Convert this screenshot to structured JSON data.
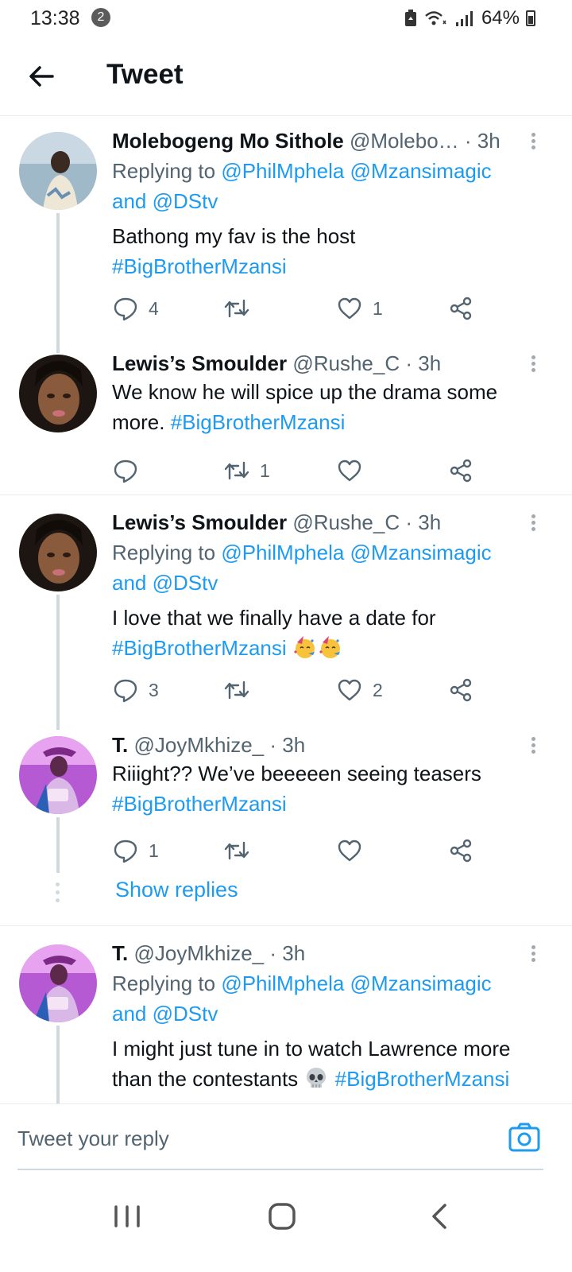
{
  "status_bar": {
    "time": "13:38",
    "notification_count": "2",
    "battery": "64%"
  },
  "header": {
    "title": "Tweet"
  },
  "tweets": [
    {
      "name": "Molebogeng Mo Sithole",
      "meta": "@Molebo… · 3h",
      "replying_prefix": "Replying to",
      "mentions": "@PhilMphela @Mzansimagic",
      "and_text": "and",
      "mention_last": "@DStv",
      "text_plain": "Bathong my fav is the host",
      "hashtag": "#BigBrotherMzansi",
      "reply_count": "4",
      "retweet_count": "",
      "like_count": "1"
    },
    {
      "name": "Lewis’s Smoulder",
      "meta": "@Rushe_C · 3h",
      "text_plain": "We know he will spice up the drama some more.",
      "hashtag": "#BigBrotherMzansi",
      "reply_count": "",
      "retweet_count": "1",
      "like_count": ""
    },
    {
      "name": "Lewis’s Smoulder",
      "meta": "@Rushe_C · 3h",
      "replying_prefix": "Replying to",
      "mentions": "@PhilMphela @Mzansimagic",
      "and_text": "and",
      "mention_last": "@DStv",
      "text_plain": "I love that we finally have a date for",
      "hashtag": "#BigBrotherMzansi",
      "reply_count": "3",
      "retweet_count": "",
      "like_count": "2"
    },
    {
      "name": "T.",
      "meta": "@JoyMkhize_ · 3h",
      "text_plain": "Riiight?? We’ve beeeeen seeing teasers",
      "hashtag": "#BigBrotherMzansi",
      "reply_count": "1",
      "retweet_count": "",
      "like_count": ""
    },
    {
      "name": "T.",
      "meta": "@JoyMkhize_ · 3h",
      "replying_prefix": "Replying to",
      "mentions": "@PhilMphela @Mzansimagic",
      "and_text": "and",
      "mention_last": "@DStv",
      "text_plain": "I might just tune in to watch Lawrence more than the contestants",
      "hashtag": "#BigBrotherMzansi"
    }
  ],
  "show_replies": "Show replies",
  "compose": {
    "placeholder": "Tweet your reply"
  },
  "colors": {
    "accent": "#1d9bf0",
    "muted": "#536471",
    "thread": "#cfd9de"
  }
}
